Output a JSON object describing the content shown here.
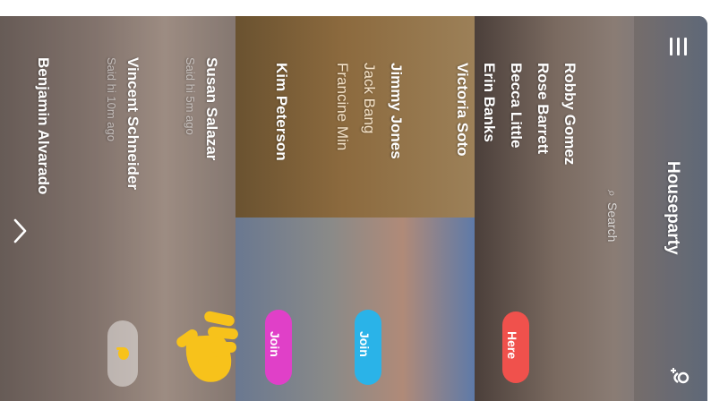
{
  "header": {
    "title": "Houseparty",
    "search_placeholder": "Search",
    "menu_icon": "hamburger-menu-icon",
    "add_friend_icon": "add-person-icon"
  },
  "rooms": [
    {
      "members": [
        "Robby Gomez",
        "Rose Barrett",
        "Becca Little",
        "Erin Banks",
        "Victoria Soto"
      ],
      "action": "Here",
      "color": "#f0514c"
    },
    {
      "members": [
        "Jimmy Jones",
        "Jack Bang",
        "Francine Min"
      ],
      "action": "Join",
      "color": "#2ab3e8"
    },
    {
      "members": [
        "Kim Peterson"
      ],
      "action": "Join",
      "color": "#e040c8"
    }
  ],
  "friends": [
    {
      "name": "Susan Salazar",
      "status": "Said hi 5m ago"
    },
    {
      "name": "Vincent Schneider",
      "status": "Said hi 10m ago"
    },
    {
      "name": "Benjamin Alvarado",
      "status": ""
    }
  ],
  "wave_icon": "waving-hand-icon",
  "chevron_icon": "chevron-right-icon",
  "colors": {
    "accent_yellow": "#f7c21b",
    "text": "#ffffff"
  }
}
